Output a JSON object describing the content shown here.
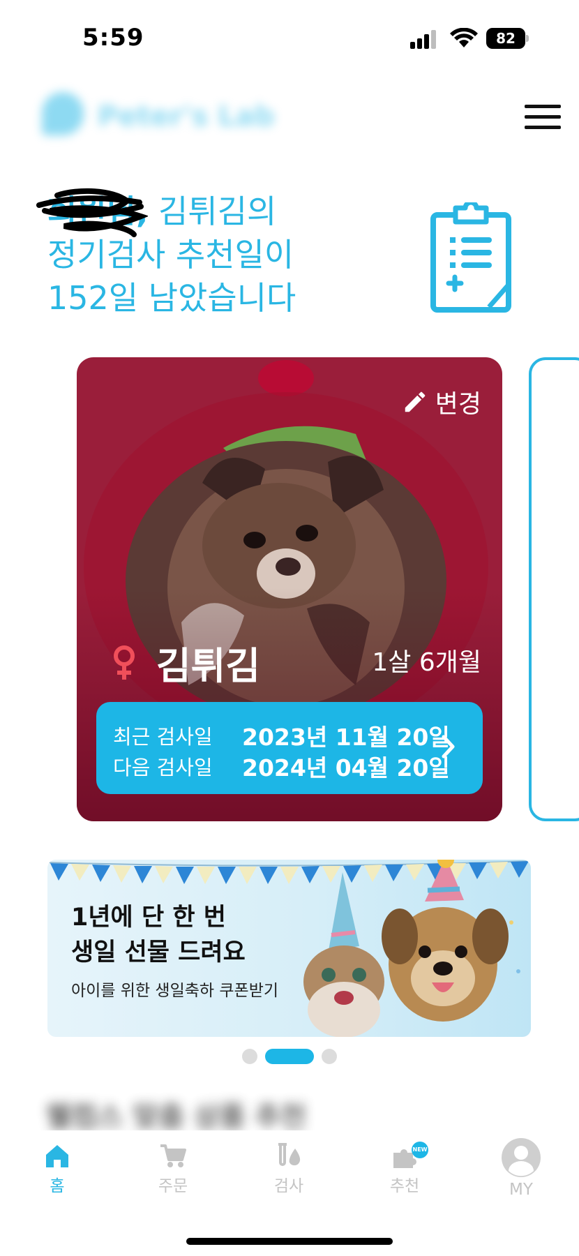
{
  "status_bar": {
    "time": "5:59",
    "battery": "82"
  },
  "header": {
    "brand_name": "Peter's Lab",
    "menu_icon": "hamburger-menu-icon"
  },
  "greeting": {
    "user_name": "회원님,",
    "line1_rest": " 김튀김의",
    "line2": "정기검사 추천일이",
    "line3": "152일 남았습니다",
    "icon": "clipboard-medical-icon"
  },
  "pet_card": {
    "edit_label": "변경",
    "pet_name": "김튀김",
    "pet_sex_icon": "female-icon",
    "pet_age": "1살 6개월",
    "last_exam_label": "최근 검사일",
    "last_exam_date": "2023년 11월 20일",
    "next_exam_label": "다음 검사일",
    "next_exam_date": "2024년 04월 20일"
  },
  "banner": {
    "title_line1": "1년에 단 한 번",
    "title_line2": "생일 선물 드려요",
    "subtitle": "아이를 위한 생일축하 쿠폰받기"
  },
  "pager": {
    "count": 3,
    "active_index": 1
  },
  "section": {
    "title": "웰컴스 맞춤 상품 추천"
  },
  "bottom_nav": {
    "items": [
      {
        "label": "홈",
        "icon": "home-icon",
        "active": true
      },
      {
        "label": "주문",
        "icon": "cart-icon",
        "active": false
      },
      {
        "label": "검사",
        "icon": "test-tube-icon",
        "active": false
      },
      {
        "label": "추천",
        "icon": "puzzle-icon",
        "active": false,
        "badge": "NEW"
      },
      {
        "label": "MY",
        "icon": "profile-icon",
        "active": false
      }
    ]
  },
  "colors": {
    "accent": "#2AB6E3",
    "card_red": "#D8163F",
    "exam_box": "#1DB6E6",
    "female": "#F04F5A"
  }
}
